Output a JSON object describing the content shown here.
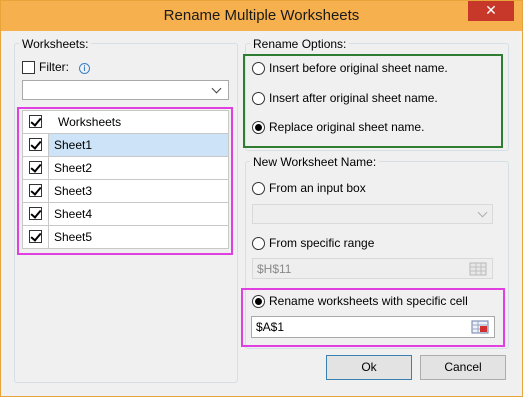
{
  "window": {
    "title": "Rename Multiple Worksheets",
    "close_glyph": "✕"
  },
  "worksheets_panel": {
    "legend": "Worksheets:",
    "filter": {
      "label": "Filter:",
      "checked": false,
      "info_icon": "i",
      "value": ""
    },
    "list": {
      "header": {
        "label": "Worksheets",
        "checked": true
      },
      "items": [
        {
          "label": "Sheet1",
          "checked": true,
          "selected": true
        },
        {
          "label": "Sheet2",
          "checked": true,
          "selected": false
        },
        {
          "label": "Sheet3",
          "checked": true,
          "selected": false
        },
        {
          "label": "Sheet4",
          "checked": true,
          "selected": false
        },
        {
          "label": "Sheet5",
          "checked": true,
          "selected": false
        }
      ]
    }
  },
  "rename_options": {
    "legend": "Rename Options:",
    "options": [
      {
        "label": "Insert before original sheet name.",
        "selected": false
      },
      {
        "label": "Insert after original sheet name.",
        "selected": false
      },
      {
        "label": "Replace original sheet name.",
        "selected": true
      }
    ]
  },
  "new_name": {
    "legend": "New Worksheet Name:",
    "from_input_box": {
      "label": "From an input box",
      "selected": false,
      "value": ""
    },
    "from_range": {
      "label": "From specific range",
      "selected": false,
      "value": "$H$11"
    },
    "specific_cell": {
      "label": "Rename worksheets with specific cell",
      "selected": true,
      "value": "$A$1"
    }
  },
  "buttons": {
    "ok": "Ok",
    "cancel": "Cancel"
  },
  "colors": {
    "title_bar": "#f6b04e",
    "highlight_magenta": "#e040e0",
    "highlight_green": "#2e7d32",
    "selection": "#cde3f7"
  }
}
